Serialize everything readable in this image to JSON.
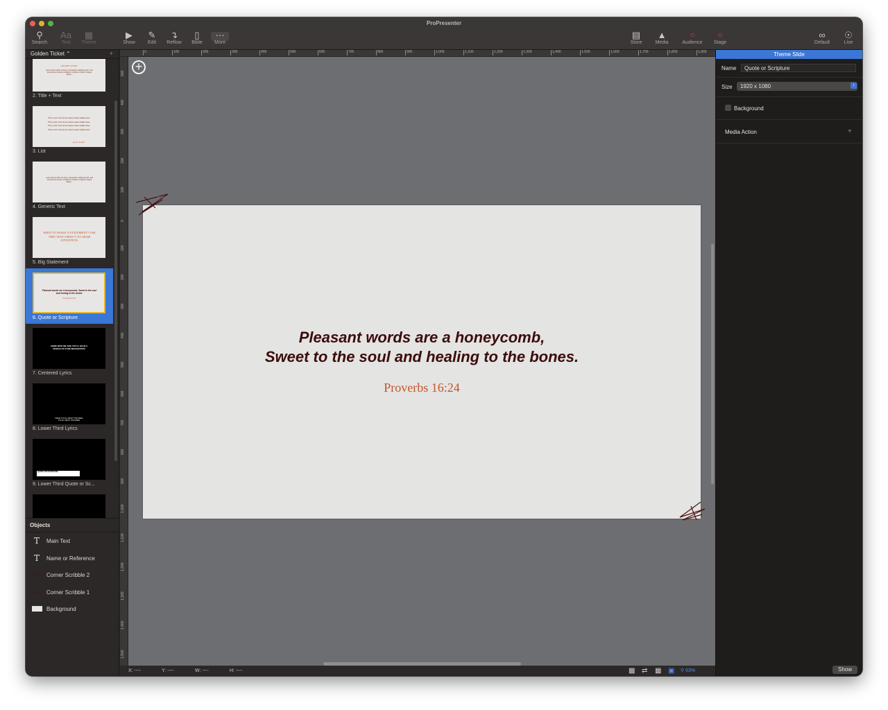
{
  "app": {
    "title": "ProPresenter"
  },
  "toolbar": {
    "search": "Search",
    "text": "Text",
    "theme": "Theme",
    "show": "Show",
    "edit": "Edit",
    "reflow": "Reflow",
    "bible": "Bible",
    "more": "More",
    "store": "Store",
    "media": "Media",
    "audience": "Audience",
    "stage": "Stage",
    "default": "Default",
    "live": "Live"
  },
  "library": {
    "name": "Golden Ticket ⌃",
    "thumbs": [
      {
        "label": "2.  Title + Text",
        "mini": "GOLDEN TICKET",
        "mini2": "lorem ipsum dolor sit amet, consectetur adipiscing elit, sed do eiusmod tempor incididunt ut labore et dolore magna aliqua..."
      },
      {
        "label": "3.  List",
        "mini": "This is a list. This can be used to state multiple items.",
        "mini2": "you're loved!"
      },
      {
        "label": "4.  Generic Text",
        "mini": "Lorem ipsum dolor sit amet, consectetur adipiscing elit, sed do eiusmod tempor incididunt ut labore et dolore magna aliqua..."
      },
      {
        "label": "5.  Big Statement",
        "mini": "NEED TO MAKE A STATEMENT? USE THIS TEXT OBJECT TO GRAB ATTENTION."
      },
      {
        "label": "6.  Quote or Scripture",
        "mini": "Pleasant words are a honeycomb, Sweet to the soul and healing to the bones.",
        "mini2": "Proverbs 16:24"
      },
      {
        "label": "7.  Centered Lyrics",
        "mini": "COME WITH ME AND YOU'LL BE IN A WORLD OF PURE IMAGINATION"
      },
      {
        "label": "8.  Lower Third Lyrics",
        "mini": "I MEAN IT'S ALL ABOUT THE DIMES, IT'S ALL ABOUT THE DIMES"
      },
      {
        "label": "9.  Lower Third Quote or Sc...",
        "mini": "QUOTE OR SCRIPTURE"
      }
    ]
  },
  "objects": {
    "header": "Objects",
    "items": [
      "Main Text",
      "Name or Reference",
      "Corner Scribble 2",
      "Corner Scribble 1",
      "Background"
    ]
  },
  "slide": {
    "line1": "Pleasant words are a honeycomb,",
    "line2": "Sweet to the soul and healing to the bones.",
    "reference": "Proverbs 16:24"
  },
  "ruler": {
    "top": [
      "0",
      "100",
      "200",
      "300",
      "400",
      "500",
      "600",
      "700",
      "800",
      "900",
      "1,000",
      "1,100",
      "1,200",
      "1,300",
      "1,400",
      "1,500",
      "1,600",
      "1,700",
      "1,800",
      "1,900"
    ],
    "left": [
      "500",
      "400",
      "300",
      "200",
      "100",
      "0",
      "100",
      "200",
      "300",
      "400",
      "500",
      "600",
      "700",
      "800",
      "900",
      "1,000",
      "1,100",
      "1,200",
      "1,300",
      "1,400",
      "1,500"
    ]
  },
  "status": {
    "x": "X:  ----",
    "y": "Y:  ----",
    "w": "W:  ----",
    "h": "H:  ----",
    "zoom": "63%"
  },
  "inspector": {
    "header": "Theme Slide",
    "name_label": "Name",
    "name_value": "Quote or Scripture",
    "size_label": "Size",
    "size_value": "1920 x 1080",
    "background_label": "Background",
    "media_action_label": "Media Action",
    "show_button": "Show"
  },
  "colors": {
    "accent": "#3a77d6",
    "slide_text": "#3b0c0c",
    "reference": "#c2562b",
    "selection_border": "#e3b72a"
  }
}
